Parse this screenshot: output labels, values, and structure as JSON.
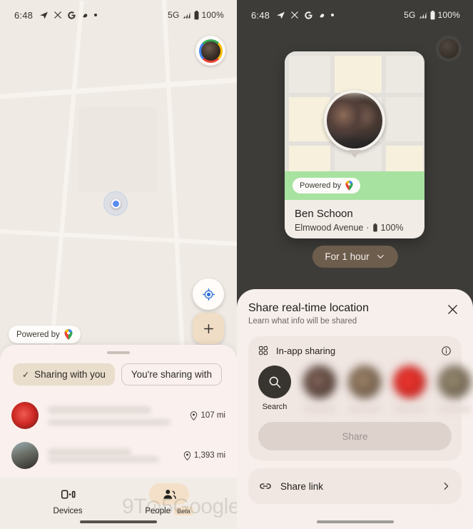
{
  "status_bar": {
    "time": "6:48",
    "left_icons": [
      "telegram-icon",
      "x-icon",
      "google-icon",
      "app-icon",
      "dot-icon"
    ],
    "network": "5G",
    "battery": "100%"
  },
  "left_screen": {
    "map": {
      "powered_by_label": "Powered by",
      "powered_by_icon": "google-maps-pin-icon",
      "my_location_icon": "crosshair-icon",
      "add_icon": "plus-icon",
      "avatar_name": "account-avatar"
    },
    "sheet": {
      "chips": [
        {
          "label": "Sharing with you",
          "selected": true,
          "icon": "check-icon"
        },
        {
          "label": "You're sharing with",
          "selected": false
        }
      ],
      "people": [
        {
          "name": "",
          "detail": "",
          "distance": "107 mi",
          "distance_icon": "location-pin-icon"
        },
        {
          "name": "",
          "detail": "",
          "distance": "1,393 mi",
          "distance_icon": "location-pin-icon"
        }
      ]
    },
    "bottom_nav": [
      {
        "label": "Devices",
        "icon": "devices-icon",
        "active": false,
        "badge": ""
      },
      {
        "label": "People",
        "icon": "people-icon",
        "active": true,
        "badge": "Beta"
      }
    ],
    "watermark": "9TO5Google"
  },
  "right_screen": {
    "location_card": {
      "powered_by_label": "Powered by",
      "powered_by_icon": "google-maps-pin-icon",
      "name": "Ben Schoon",
      "address": "Elmwood Avenue",
      "separator": "·",
      "battery_icon": "battery-icon",
      "battery": "100%",
      "marker_icon": "photo-marker-icon"
    },
    "duration_pill": {
      "label": "For 1 hour",
      "icon": "chevron-down-icon"
    },
    "share_sheet": {
      "title": "Share real-time location",
      "subtitle": "Learn what info will be shared",
      "close_icon": "close-icon",
      "in_app": {
        "label": "In-app sharing",
        "section_icon": "share-grid-icon",
        "info_icon": "info-icon",
        "search_label": "Search",
        "search_icon": "search-icon",
        "contacts": [
          "contact-1",
          "contact-2",
          "contact-3",
          "contact-4"
        ]
      },
      "share_button": {
        "label": "Share",
        "disabled": true
      },
      "share_link": {
        "label": "Share link",
        "icon": "link-icon",
        "chevron": "chevron-right-icon"
      }
    },
    "watermark": "9TO5Google"
  },
  "colors": {
    "left_map_bg": "#efeae4",
    "left_sheet_bg": "#faf1ee",
    "chip_selected": "#e9ddcc",
    "fab_add": "#f0ddc6",
    "right_scrim": "#3d3c39",
    "card_green": "#a7e2a0",
    "duration_pill": "#6d5d4d",
    "share_sheet_bg": "#f7efec",
    "accent_blue": "#5b8def"
  }
}
